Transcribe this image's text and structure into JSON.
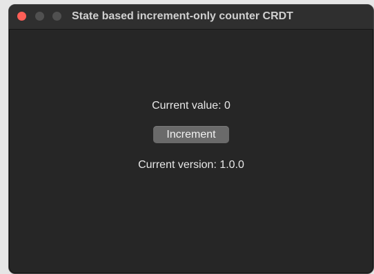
{
  "window": {
    "title": "State based increment-only counter CRDT"
  },
  "counter": {
    "value_text": "Current value: 0",
    "increment_label": "Increment",
    "version_text": "Current version: 1.0.0"
  },
  "colors": {
    "close": "#fe5f57",
    "inactive_button": "#505050",
    "window_bg": "#262626",
    "button_bg": "#6a6a6a"
  },
  "icons": {
    "close": "close-icon",
    "minimize": "minimize-icon",
    "maximize": "maximize-icon"
  }
}
